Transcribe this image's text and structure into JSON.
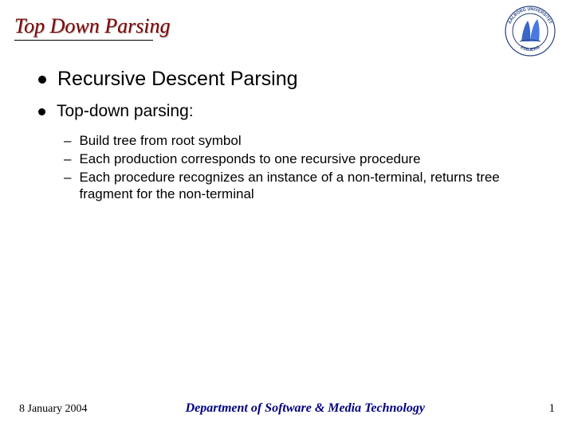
{
  "title": "Top Down Parsing",
  "logo": {
    "top_text": "AALBORG UNIVERSITET",
    "bottom_text": "ESBJERG"
  },
  "bullets": [
    {
      "level": 1,
      "text": "Recursive Descent Parsing",
      "size": "large"
    },
    {
      "level": 1,
      "text": "Top-down parsing:",
      "size": "medium"
    }
  ],
  "sub_bullets": [
    "Build tree from root symbol",
    "Each production corresponds to one recursive procedure",
    "Each procedure recognizes an instance of a non-terminal, returns tree fragment for the non-terminal"
  ],
  "footer": {
    "date": "8 January 2004",
    "department": "Department of Software & Media Technology",
    "page": "1"
  }
}
